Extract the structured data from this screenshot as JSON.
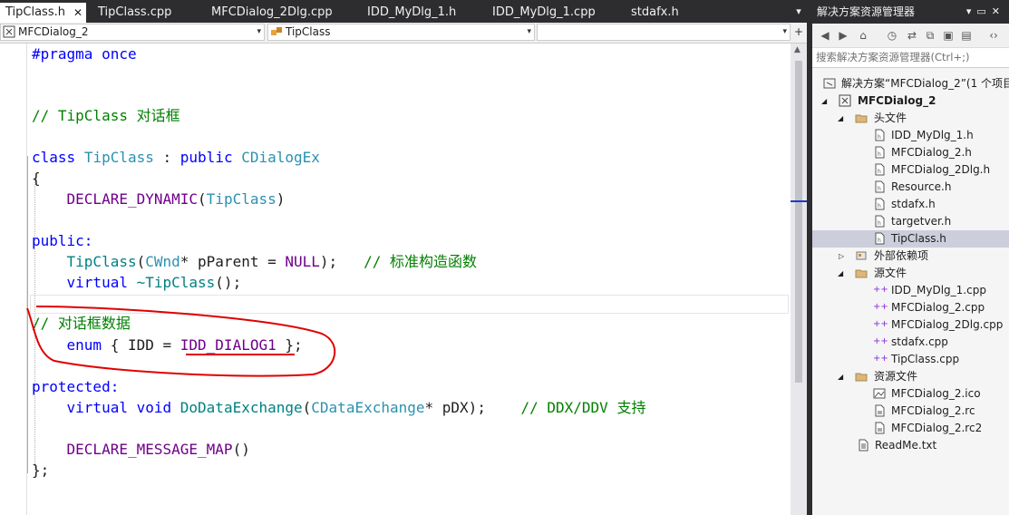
{
  "tabs": [
    {
      "label": "TipClass.h",
      "close": "✕",
      "active": true
    },
    {
      "label": "TipClass.cpp"
    },
    {
      "label": "MFCDialog_2Dlg.cpp"
    },
    {
      "label": "IDD_MyDlg_1.h"
    },
    {
      "label": "IDD_MyDlg_1.cpp"
    },
    {
      "label": "stdafx.h"
    }
  ],
  "nav": {
    "project": "MFCDialog_2",
    "scope": "TipClass",
    "member": ""
  },
  "code": {
    "l1": "#pragma once",
    "l2": "// TipClass 对话框",
    "l3_kw": "class",
    "l3_name": "TipClass",
    "l3_sep": " : ",
    "l3_pub": "public",
    "l3_base": "CDialogEx",
    "l4": "{",
    "l5_m": "DECLARE_DYNAMIC",
    "l5_p1": "(",
    "l5_a": "TipClass",
    "l5_p2": ")",
    "l6": "public:",
    "l7_fn": "TipClass",
    "l7_p": "(",
    "l7_ty": "CWnd",
    "l7_r": "* pParent = ",
    "l7_null": "NULL",
    "l7_e": ");   ",
    "l7_cm": "// 标准构造函数",
    "l8_kw": "virtual",
    "l8_fn": " ~TipClass",
    "l8_e": "();",
    "l9": "// 对话框数据",
    "l10_kw": "enum",
    "l10_a": " { IDD = ",
    "l10_m": "IDD_DIALOG1",
    "l10_e": " };",
    "l11": "protected:",
    "l12_kw1": "virtual",
    "l12_kw2": " void",
    "l12_fn": " DoDataExchange",
    "l12_p": "(",
    "l12_ty": "CDataExchange",
    "l12_r": "* pDX);    ",
    "l12_cm": "// DDX/DDV 支持",
    "l13": "DECLARE_MESSAGE_MAP",
    "l13_e": "()",
    "l14": "};"
  },
  "solution_explorer": {
    "title": "解决方案资源管理器",
    "search_placeholder": "搜索解决方案资源管理器(Ctrl+;)",
    "items": [
      {
        "label": "解决方案“MFCDialog_2”(1 个项目"
      },
      {
        "label": "MFCDialog_2"
      },
      {
        "label": "头文件"
      },
      {
        "label": "IDD_MyDlg_1.h"
      },
      {
        "label": "MFCDialog_2.h"
      },
      {
        "label": "MFCDialog_2Dlg.h"
      },
      {
        "label": "Resource.h"
      },
      {
        "label": "stdafx.h"
      },
      {
        "label": "targetver.h"
      },
      {
        "label": "TipClass.h",
        "selected": true
      },
      {
        "label": "外部依赖项"
      },
      {
        "label": "源文件"
      },
      {
        "label": "IDD_MyDlg_1.cpp"
      },
      {
        "label": "MFCDialog_2.cpp"
      },
      {
        "label": "MFCDialog_2Dlg.cpp"
      },
      {
        "label": "stdafx.cpp"
      },
      {
        "label": "TipClass.cpp"
      },
      {
        "label": "资源文件"
      },
      {
        "label": "MFCDialog_2.ico"
      },
      {
        "label": "MFCDialog_2.rc"
      },
      {
        "label": "MFCDialog_2.rc2"
      },
      {
        "label": "ReadMe.txt"
      }
    ]
  },
  "colors": {
    "keyword": "#0000ff",
    "type": "#2b91af",
    "macro": "#6f008a",
    "comment": "#008000",
    "annotation": "#e00000",
    "selection": "#cccedb"
  }
}
